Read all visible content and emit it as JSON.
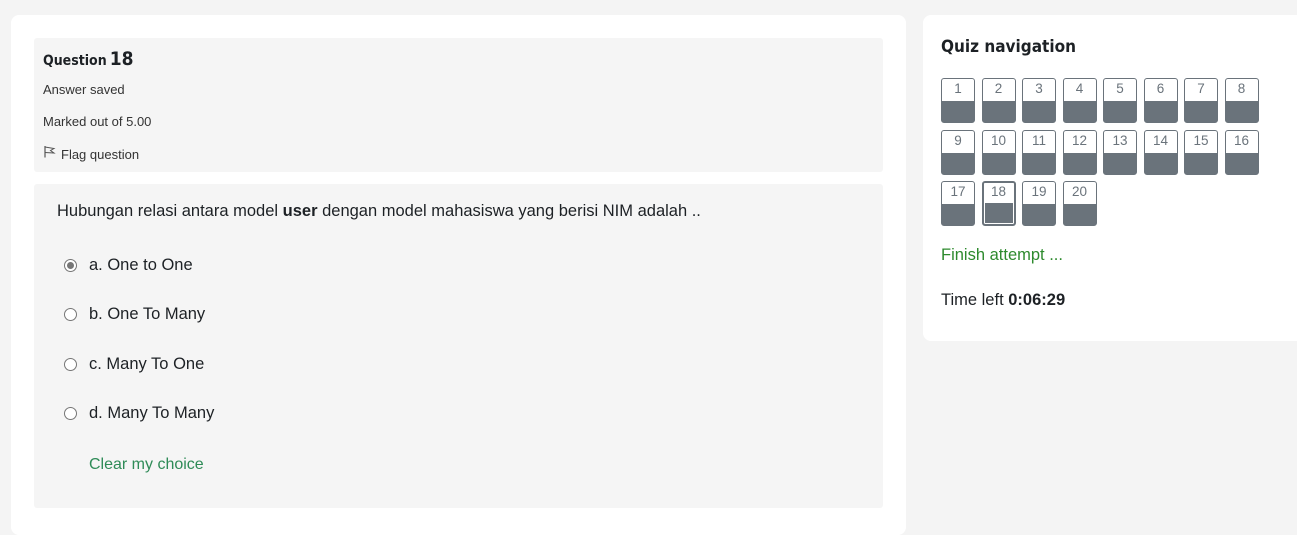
{
  "question": {
    "word": "Question",
    "number": "18",
    "state": "Answer saved",
    "marks": "Marked out of 5.00",
    "flag_label": "Flag question",
    "text_before": "Hubungan relasi antara model ",
    "text_bold": "user",
    "text_after": " dengan model mahasiswa yang berisi NIM adalah ..",
    "options": [
      {
        "label": "a. One to One",
        "checked": true
      },
      {
        "label": "b. One To Many",
        "checked": false
      },
      {
        "label": "c. Many To One",
        "checked": false
      },
      {
        "label": "d. Many To Many",
        "checked": false
      }
    ],
    "clear_label": "Clear my choice"
  },
  "nav": {
    "title": "Quiz navigation",
    "buttons": [
      "1",
      "2",
      "3",
      "4",
      "5",
      "6",
      "7",
      "8",
      "9",
      "10",
      "11",
      "12",
      "13",
      "14",
      "15",
      "16",
      "17",
      "18",
      "19",
      "20"
    ],
    "current": "18",
    "finish_label": "Finish attempt ...",
    "time_label": "Time left",
    "time_value": "0:06:29"
  },
  "colors": {
    "answered": "#6a737b",
    "link_green": "#2e8b57",
    "finish_green": "#2d8a2d"
  }
}
